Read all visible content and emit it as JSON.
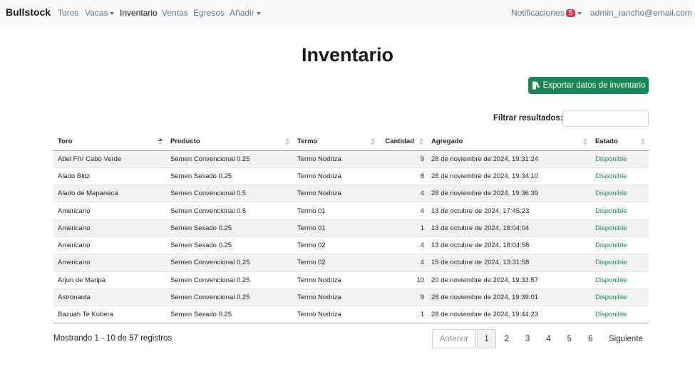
{
  "navbar": {
    "brand": "Bullstock",
    "links": [
      {
        "label": "Toros"
      },
      {
        "label": "Vacas"
      },
      {
        "label": "Inventario"
      },
      {
        "label": "Ventas"
      },
      {
        "label": "Egresos"
      },
      {
        "label": "Añadir"
      }
    ],
    "notifications_label": "Notificaciones",
    "notifications_count": "5",
    "user_email": "admin_rancho@email.com"
  },
  "page_title": "Inventario",
  "export_button_label": "Exportar datos de inventario",
  "filter": {
    "label": "Filtrar resultados:",
    "value": ""
  },
  "table": {
    "columns": [
      "Toro",
      "Producto",
      "Termo",
      "Cantidad",
      "Agregado",
      "Estado"
    ],
    "rows": [
      [
        "Abel FIV Cabo Verde",
        "Semen Convencional 0.25",
        "Termo Nodriza",
        "9",
        "28 de noviembre de 2024, 19:31:24",
        "Disponible"
      ],
      [
        "Alado Blitz",
        "Semen Sexado 0.25",
        "Termo Nodriza",
        "8",
        "28 de noviembre de 2024, 19:34:10",
        "Disponible"
      ],
      [
        "Alado de Mapaneca",
        "Semen Convencional 0.5",
        "Termo Nodriza",
        "4",
        "28 de noviembre de 2024, 19:36:39",
        "Disponible"
      ],
      [
        "Americano",
        "Semen Convencional 0.5",
        "Termo 01",
        "4",
        "13 de octubre de 2024, 17:45:23",
        "Disponible"
      ],
      [
        "Americano",
        "Semen Sexado 0.25",
        "Termo 01",
        "1",
        "13 de octubre de 2024, 18:04:04",
        "Disponible"
      ],
      [
        "Americano",
        "Semen Sexado 0.25",
        "Termo 02",
        "4",
        "13 de octubre de 2024, 18:04:58",
        "Disponible"
      ],
      [
        "Americano",
        "Semen Convencional 0.25",
        "Termo 02",
        "4",
        "15 de octubre de 2024, 13:31:58",
        "Disponible"
      ],
      [
        "Arjun de Maripá",
        "Semen Convencional 0.25",
        "Termo Nodriza",
        "10",
        "20 de noviembre de 2024, 19:33:57",
        "Disponible"
      ],
      [
        "Astronauta",
        "Semen Convencional 0.25",
        "Termo Nodriza",
        "9",
        "28 de noviembre de 2024, 19:39:01",
        "Disponible"
      ],
      [
        "Bazuah Te Kubera",
        "Semen Sexado 0.25",
        "Termo Nodriza",
        "1",
        "28 de noviembre de 2024, 19:44:23",
        "Disponible"
      ]
    ]
  },
  "footer": {
    "info": "Mostrando 1 - 10 de 57 registros",
    "pagination": {
      "prev": "Anterior",
      "pages": [
        "1",
        "2",
        "3",
        "4",
        "5",
        "6"
      ],
      "next": "Siguiente"
    }
  },
  "colors": {
    "accent_green": "#198754",
    "badge_red": "#dc3545",
    "navbar_bg": "#f8f9fa"
  },
  "icons": {
    "export": "file-export-icon"
  }
}
